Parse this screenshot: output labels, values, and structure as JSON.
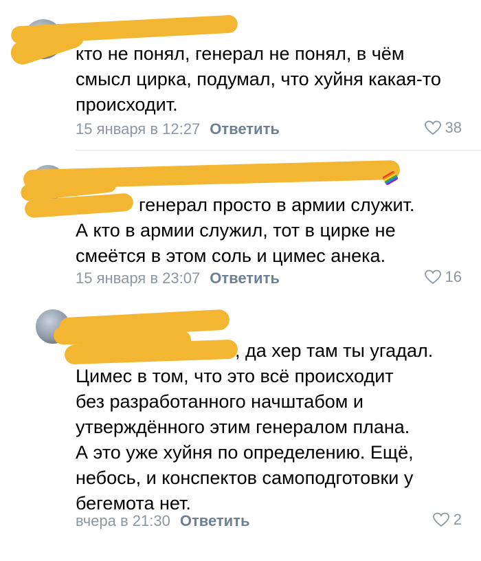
{
  "comments": [
    {
      "text": "кто не понял, генерал не понял, в чём\nсмысл цирка, подумал, что хуйня какая-то\nпроисходит.",
      "date": "15 января в 12:27",
      "reply_label": "Ответить",
      "likes": "38"
    },
    {
      "text": "генерал просто в армии служит.\nА кто в армии служил, тот в цирке не\nсмеётся в этом соль и цимес анека.",
      "date": "15 января в 23:07",
      "reply_label": "Ответить",
      "likes": "16"
    },
    {
      "text": ", да хер там ты угадал.\nЦимес в том, что это всё происходит\nбез разработанного начштабом и\nутверждённого этим генералом плана.\nА это уже хуйня по определению. Ещё,\nнебось, и конспектов самоподготовки у\nбегемота нет.",
      "date": "вчера в 21:30",
      "reply_label": "Ответить",
      "likes": "2"
    }
  ],
  "colors": {
    "censor": "#f2b632",
    "meta": "#8b96a3",
    "reply": "#6d7f93"
  }
}
